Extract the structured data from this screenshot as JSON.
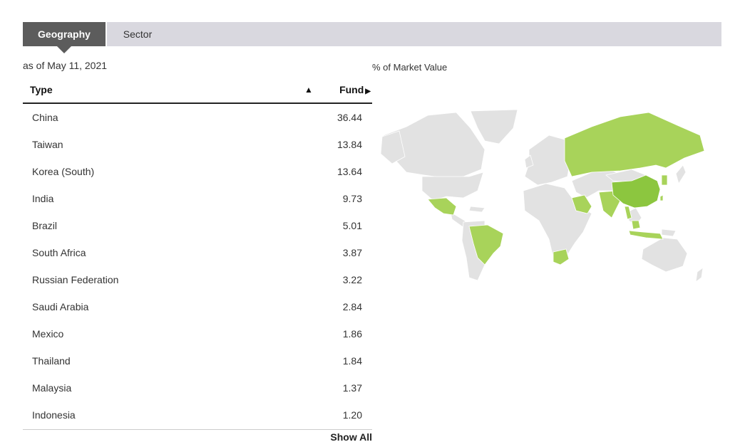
{
  "tabs": [
    {
      "label": "Geography",
      "active": true
    },
    {
      "label": "Sector",
      "active": false
    }
  ],
  "as_of": "as of May 11, 2021",
  "table": {
    "col_type": "Type",
    "col_fund": "Fund",
    "rows": [
      {
        "name": "China",
        "value": "36.44"
      },
      {
        "name": "Taiwan",
        "value": "13.84"
      },
      {
        "name": "Korea (South)",
        "value": "13.64"
      },
      {
        "name": "India",
        "value": "9.73"
      },
      {
        "name": "Brazil",
        "value": "5.01"
      },
      {
        "name": "South Africa",
        "value": "3.87"
      },
      {
        "name": "Russian Federation",
        "value": "3.22"
      },
      {
        "name": "Saudi Arabia",
        "value": "2.84"
      },
      {
        "name": "Mexico",
        "value": "1.86"
      },
      {
        "name": "Thailand",
        "value": "1.84"
      },
      {
        "name": "Malaysia",
        "value": "1.37"
      },
      {
        "name": "Indonesia",
        "value": "1.20"
      }
    ],
    "show_all": "Show All"
  },
  "map": {
    "label": "% of Market Value",
    "colors": {
      "land": "#e2e2e2",
      "highlight": "#a8d35a",
      "top": "#8cc63f",
      "border": "#ffffff"
    }
  }
}
